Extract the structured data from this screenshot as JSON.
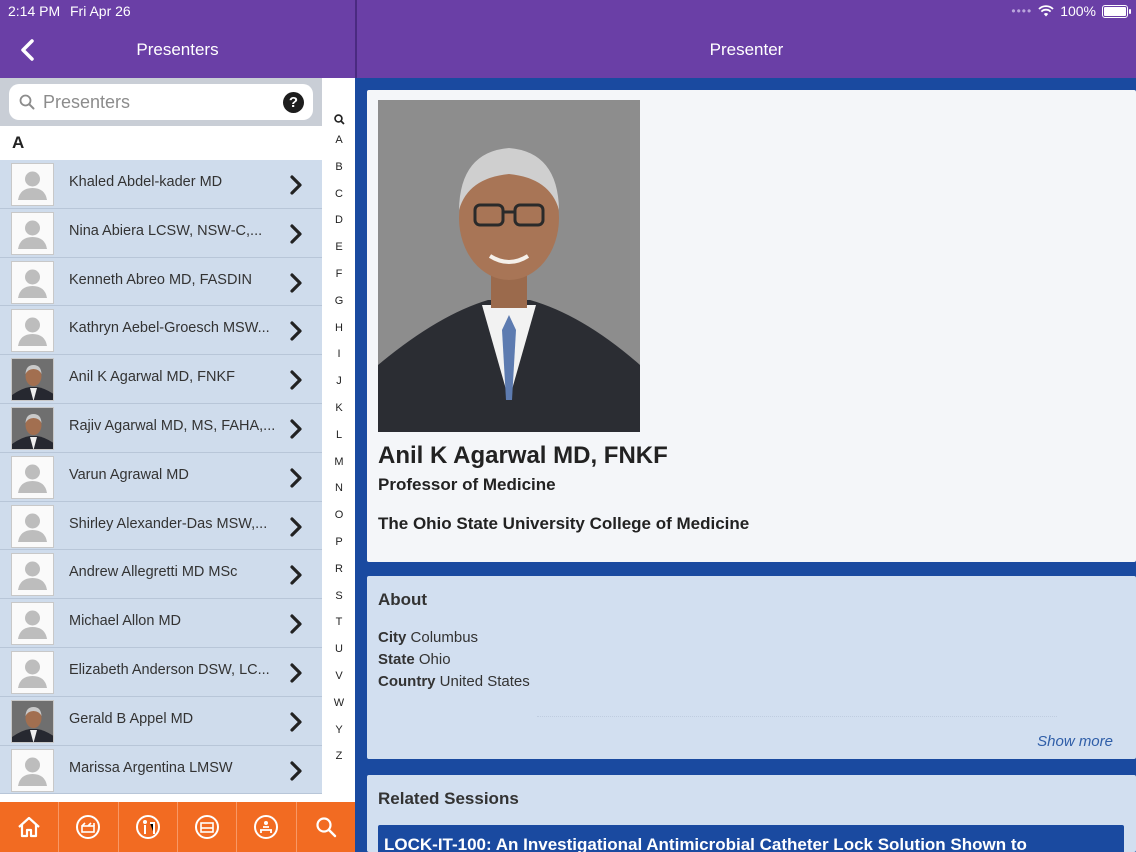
{
  "status_bar": {
    "time": "2:14 PM",
    "date": "Fri Apr 26",
    "battery": "100%",
    "icons": [
      "signal-dots-icon",
      "wifi-icon",
      "battery-icon"
    ]
  },
  "left_header": {
    "title": "Presenters",
    "back_icon": "chevron-left-icon"
  },
  "right_header": {
    "title": "Presenter"
  },
  "search": {
    "placeholder": "Presenters",
    "value": "",
    "help_label": "?"
  },
  "list": {
    "section_letter": "A",
    "presenters": [
      {
        "name": "Khaled Abdel-kader MD",
        "photo": "placeholder"
      },
      {
        "name": "Nina Abiera LCSW, NSW-C,...",
        "photo": "placeholder"
      },
      {
        "name": "Kenneth Abreo MD, FASDIN",
        "photo": "placeholder"
      },
      {
        "name": "Kathryn Aebel-Groesch MSW...",
        "photo": "placeholder"
      },
      {
        "name": "Anil K Agarwal MD, FNKF",
        "photo": "portrait"
      },
      {
        "name": "Rajiv Agarwal MD, MS, FAHA,...",
        "photo": "portrait"
      },
      {
        "name": "Varun Agrawal MD",
        "photo": "placeholder"
      },
      {
        "name": "Shirley Alexander-Das MSW,...",
        "photo": "placeholder"
      },
      {
        "name": "Andrew Allegretti MD MSc",
        "photo": "placeholder"
      },
      {
        "name": "Michael Allon MD",
        "photo": "placeholder"
      },
      {
        "name": "Elizabeth Anderson DSW,  LC...",
        "photo": "placeholder"
      },
      {
        "name": "Gerald B Appel MD",
        "photo": "portrait"
      },
      {
        "name": "Marissa Argentina LMSW",
        "photo": "placeholder"
      }
    ]
  },
  "index_bar": [
    "A",
    "B",
    "C",
    "D",
    "E",
    "F",
    "G",
    "H",
    "I",
    "J",
    "K",
    "L",
    "M",
    "N",
    "O",
    "P",
    "R",
    "S",
    "T",
    "U",
    "V",
    "W",
    "Y",
    "Z"
  ],
  "tab_bar": {
    "tabs": [
      "home-icon",
      "schedule-icon",
      "exhibitors-icon",
      "lodging-icon",
      "meeting-icon",
      "search-icon"
    ]
  },
  "profile": {
    "name": "Anil K Agarwal MD, FNKF",
    "title": "Professor of Medicine",
    "organization": "The Ohio State University College of Medicine"
  },
  "about": {
    "heading": "About",
    "city_label": "City",
    "city": "Columbus",
    "state_label": "State",
    "state": "Ohio",
    "country_label": "Country",
    "country": "United States",
    "show_more": "Show more"
  },
  "related_sessions": {
    "heading": "Related Sessions",
    "items": [
      "LOCK-IT-100: An Investigational Antimicrobial Catheter Lock Solution Shown to"
    ]
  },
  "colors": {
    "header": "#6a3fa6",
    "accent_blue": "#1a4aa0",
    "tab_orange": "#f26b22",
    "row_bg": "#cfdcec"
  }
}
